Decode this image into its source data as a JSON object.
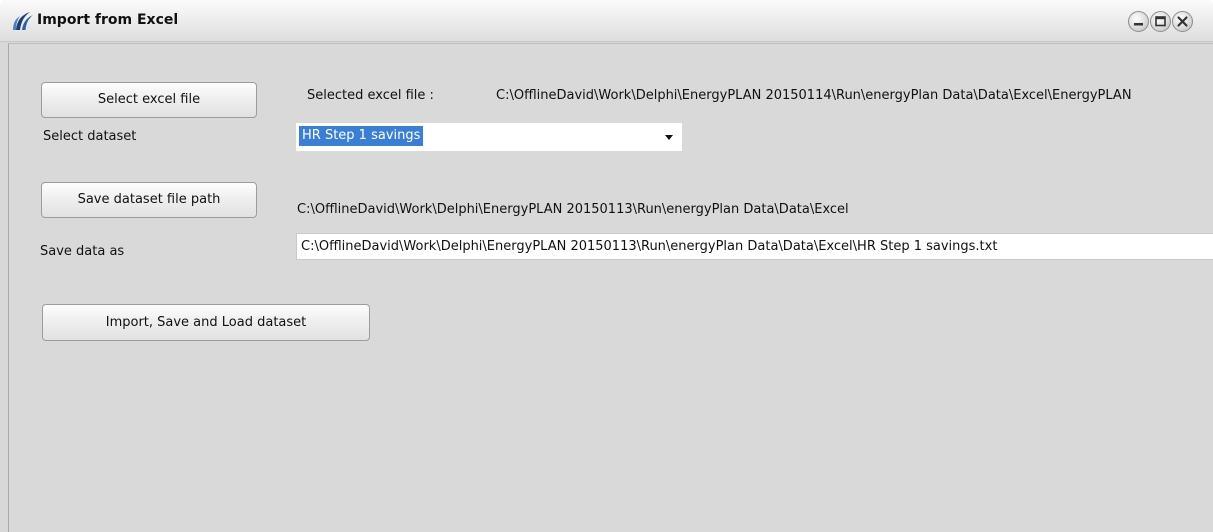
{
  "window": {
    "title": "Import from Excel"
  },
  "controls": {
    "select_excel_button": "Select excel file",
    "selected_file_label": "Selected excel file :",
    "selected_file_path": "C:\\OfflineDavid\\Work\\Delphi\\EnergyPLAN 20150114\\Run\\energyPlan Data\\Data\\Excel\\EnergyPLAN",
    "select_dataset_label": "Select dataset",
    "dataset_selected": "HR Step 1 savings",
    "save_path_button": "Save dataset file path",
    "save_path_value": "C:\\OfflineDavid\\Work\\Delphi\\EnergyPLAN 20150113\\Run\\energyPlan Data\\Data\\Excel",
    "save_as_label": "Save data as",
    "save_as_value": "C:\\OfflineDavid\\Work\\Delphi\\EnergyPLAN 20150113\\Run\\energyPlan Data\\Data\\Excel\\HR Step 1 savings.txt",
    "import_button": "Import,  Save and Load dataset"
  },
  "icons": {
    "app": "app-logo-icon",
    "minimize": "minimize-icon",
    "maximize": "maximize-icon",
    "close": "close-icon",
    "dropdown": "chevron-down-icon"
  },
  "colors": {
    "selection": "#3a7fd4",
    "background": "#d9d9d9"
  }
}
